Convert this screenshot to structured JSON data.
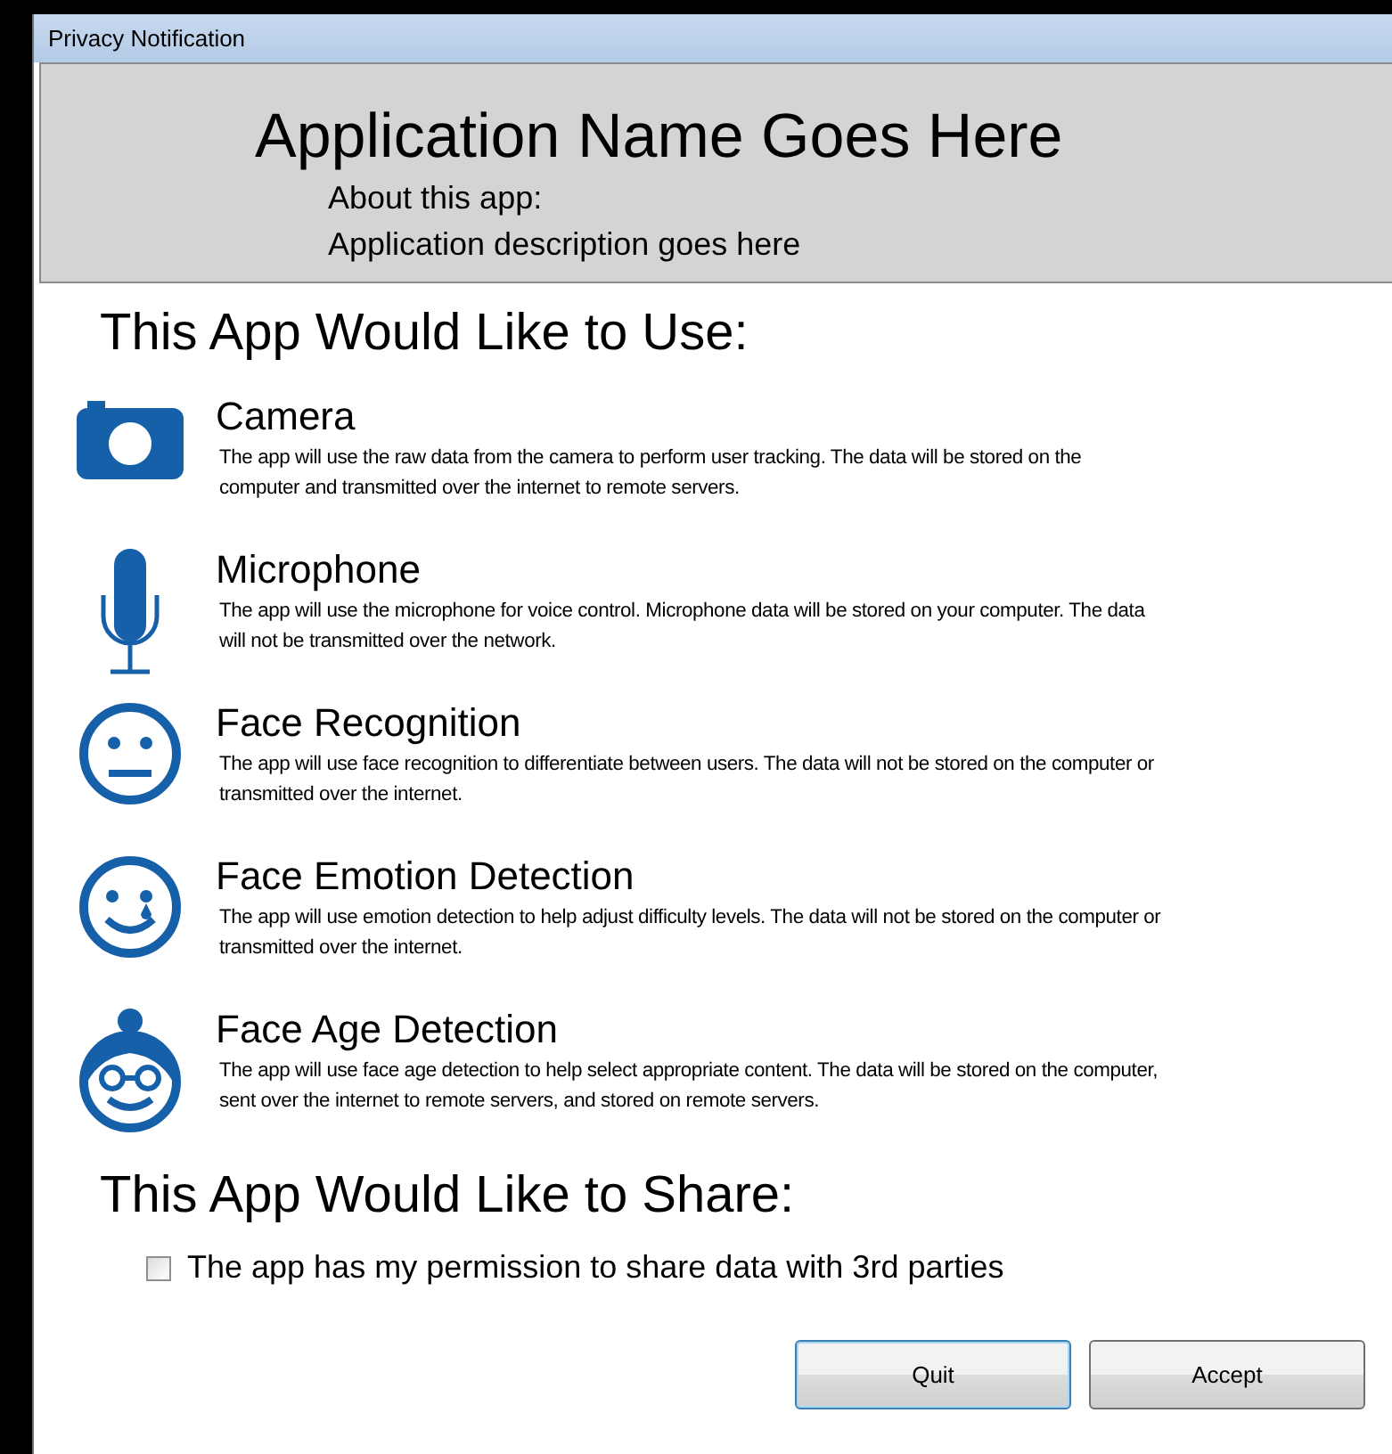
{
  "window": {
    "title": "Privacy Notification"
  },
  "header": {
    "app_name": "Application Name Goes Here",
    "about_label": "About this app:",
    "description": "Application description goes here"
  },
  "use_heading": "This App Would Like to Use:",
  "permissions": [
    {
      "kind": "camera",
      "title": "Camera",
      "description": "The app will use the raw data from the camera to perform user tracking. The data will be stored on the computer and transmitted over the internet to remote servers."
    },
    {
      "kind": "microphone",
      "title": "Microphone",
      "description": "The app will use the microphone for voice control. Microphone data will be stored on your computer. The data will not be transmitted over the network."
    },
    {
      "kind": "face-neutral",
      "title": "Face Recognition",
      "description": "The app will use face recognition to differentiate between users. The data will not be stored on the computer or transmitted over the internet."
    },
    {
      "kind": "face-tear",
      "title": "Face Emotion Detection",
      "description": "The app will use emotion detection to help adjust difficulty levels. The data will not be stored on the computer or transmitted over the internet."
    },
    {
      "kind": "face-glasses",
      "title": "Face Age Detection",
      "description": "The app will use face age detection to help select appropriate content. The data will be stored on the computer, sent over the internet to remote servers, and stored on remote servers."
    }
  ],
  "share_heading": "This App Would Like to Share:",
  "share_option": {
    "label": "The app has my permission to share data with 3rd parties",
    "checked": false
  },
  "buttons": [
    {
      "label": "Quit",
      "focused": true
    },
    {
      "label": "Accept",
      "focused": false
    }
  ]
}
